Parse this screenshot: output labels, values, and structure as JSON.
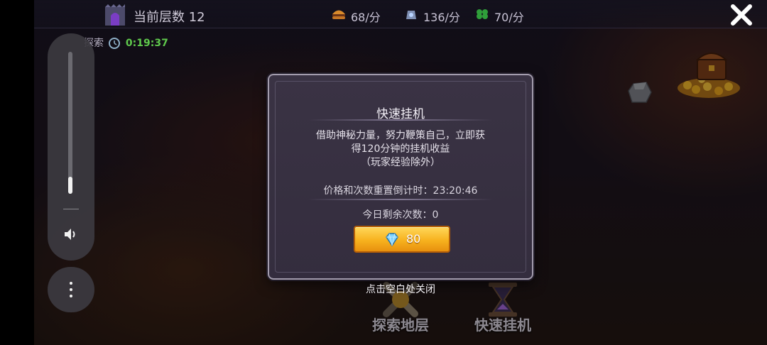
{
  "topbar": {
    "floor_label": "当前层数 12",
    "resources": [
      {
        "icon": "burger-icon",
        "value": "68/分"
      },
      {
        "icon": "gem-bag-icon",
        "value": "136/分"
      },
      {
        "icon": "clover-icon",
        "value": "70/分"
      }
    ]
  },
  "explore": {
    "label": "探索",
    "time": "0:19:37"
  },
  "modal": {
    "title": "快速挂机",
    "description_line1": "借助神秘力量，努力鞭策自己，立即获",
    "description_line2": "得120分钟的挂机收益",
    "description_line3": "（玩家经验除外）",
    "reset_label": "价格和次数重置倒计时：",
    "reset_time": "23:20:46",
    "remaining_label": "今日剩余次数：",
    "remaining_count": "0",
    "price": "80"
  },
  "tap_close": "点击空白处关闭",
  "bottom_menu": {
    "explore_floor": "探索地层",
    "quick_idle": "快速挂机"
  },
  "system_volume": {
    "level_fraction": 0.12
  },
  "colors": {
    "accent_gold": "#f7b21e",
    "timer_green": "#5fc84c",
    "panel_bg": "#342d3e"
  }
}
